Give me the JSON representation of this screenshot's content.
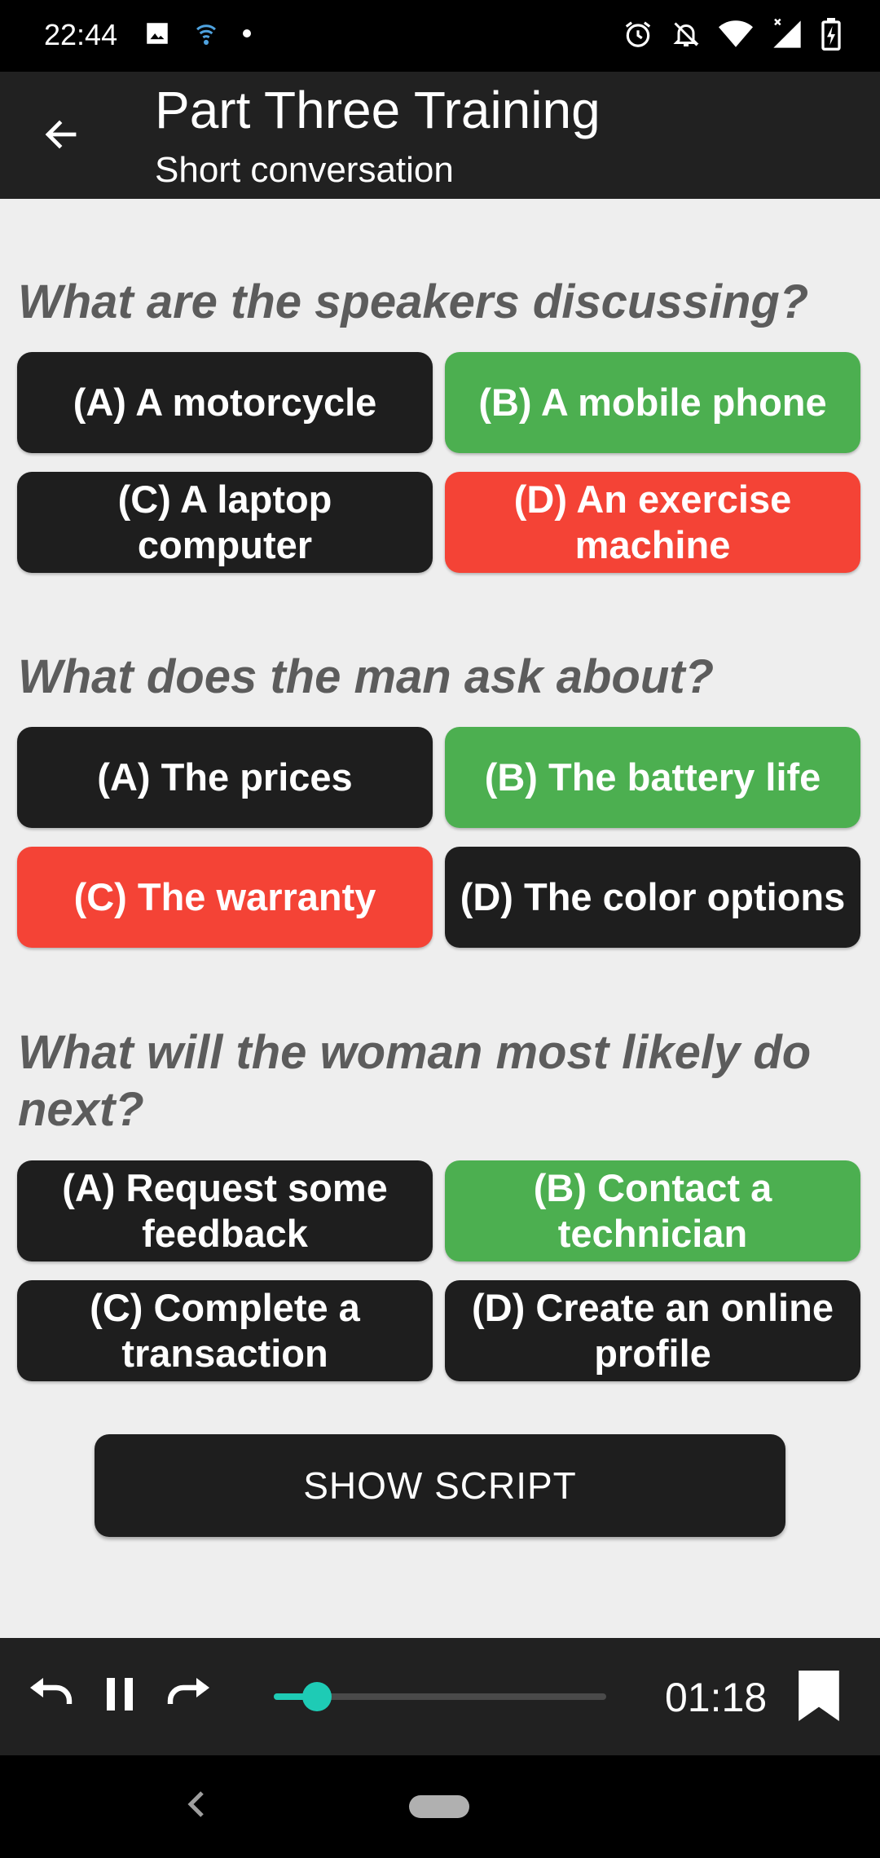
{
  "status_bar": {
    "time": "22:44",
    "left_icons": [
      "image-icon",
      "wifi-activity-icon",
      "dot-icon"
    ],
    "right_icons": [
      "alarm-icon",
      "notifications-off-icon",
      "wifi-icon",
      "signal-icon",
      "battery-charging-icon"
    ]
  },
  "app_bar": {
    "title": "Part Three Training",
    "subtitle": "Short conversation",
    "back_icon": "arrow-back-icon"
  },
  "questions": [
    {
      "text": "What are the speakers discussing?",
      "options": [
        {
          "label": "(A) A motorcycle",
          "state": "default"
        },
        {
          "label": "(B) A mobile phone",
          "state": "correct"
        },
        {
          "label": "(C) A laptop computer",
          "state": "default"
        },
        {
          "label": "(D) An exercise machine",
          "state": "wrong"
        }
      ]
    },
    {
      "text": "What does the man ask about?",
      "options": [
        {
          "label": "(A) The prices",
          "state": "default"
        },
        {
          "label": "(B) The battery life",
          "state": "correct"
        },
        {
          "label": "(C) The warranty",
          "state": "wrong"
        },
        {
          "label": "(D) The color options",
          "state": "default"
        }
      ]
    },
    {
      "text": "What will the woman most likely do next?",
      "options": [
        {
          "label": "(A) Request some feedback",
          "state": "default"
        },
        {
          "label": "(B) Contact a technician",
          "state": "correct"
        },
        {
          "label": "(C) Complete a transaction",
          "state": "default"
        },
        {
          "label": "(D) Create an online profile",
          "state": "default"
        }
      ]
    }
  ],
  "show_script_label": "SHOW SCRIPT",
  "player": {
    "time": "01:18",
    "progress_fraction": 0.13,
    "controls": [
      "rewind-icon",
      "pause-icon",
      "forward-icon",
      "bookmark-icon"
    ]
  },
  "colors": {
    "correct": "#4caf50",
    "wrong": "#f44336",
    "default": "#1e1e1e",
    "accent": "#1ecbb5"
  }
}
